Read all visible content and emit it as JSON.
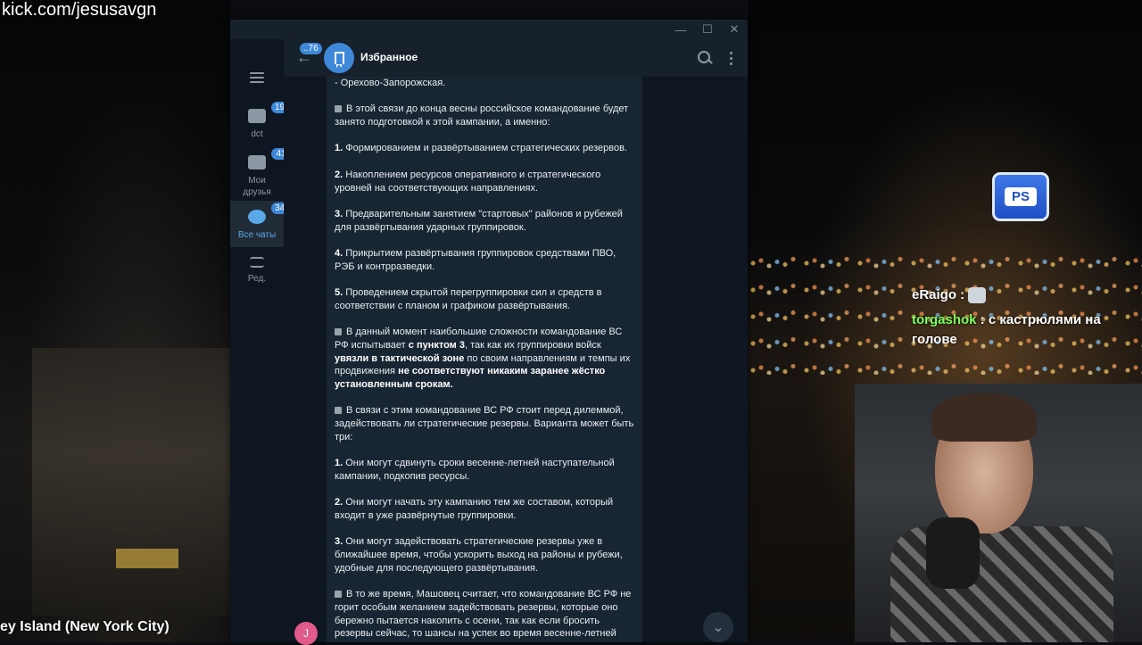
{
  "overlay": {
    "url": "kick.com/jesusavgn",
    "location": "ey Island (New York City)",
    "ps_badge": "PS"
  },
  "stream_chat": [
    {
      "user": "eRaigo",
      "sep": " :",
      "text": ""
    },
    {
      "user": "torgashok",
      "sep": " :",
      "text": " с кастрюлями на голове"
    }
  ],
  "window": {
    "min": "—",
    "max": "☐",
    "close": "✕"
  },
  "folders": [
    {
      "label": "dct",
      "badge": "191"
    },
    {
      "label": "Мои друзья",
      "badge": "41"
    },
    {
      "label": "Все чаты",
      "badge": "349"
    },
    {
      "label": "Ред.",
      "badge": ""
    }
  ],
  "header": {
    "back_badge": "..76",
    "title": "Избранное"
  },
  "message": {
    "paragraphs": [
      {
        "runs": [
          {
            "t": "- Орехово-Запорожская."
          }
        ]
      },
      {
        "bullet": true,
        "runs": [
          {
            "t": "В этой связи до конца весны российское командование будет занято подготовкой к этой кампании, а именно:"
          }
        ]
      },
      {
        "runs": [
          {
            "t": "1.",
            "b": true
          },
          {
            "t": " Формированием и развёртыванием стратегических резервов."
          }
        ]
      },
      {
        "runs": [
          {
            "t": "2.",
            "b": true
          },
          {
            "t": " Накоплением ресурсов оперативного и стратегического уровней на соответствующих направлениях."
          }
        ]
      },
      {
        "runs": [
          {
            "t": "3.",
            "b": true
          },
          {
            "t": " Предварительным занятием \"стартовых\" районов и рубежей для развёртывания ударных группировок."
          }
        ]
      },
      {
        "runs": [
          {
            "t": "4.",
            "b": true
          },
          {
            "t": " Прикрытием развёртывания группировок средствами ПВО, РЭБ и контрразведки."
          }
        ]
      },
      {
        "runs": [
          {
            "t": "5.",
            "b": true
          },
          {
            "t": " Проведением скрытой перегруппировки сил и средств в соответствии с планом и графиком развёртывания."
          }
        ]
      },
      {
        "bullet": true,
        "runs": [
          {
            "t": "В данный момент наибольшие сложности командование ВС РФ испытывает "
          },
          {
            "t": "с пунктом 3",
            "b": true
          },
          {
            "t": ", так как их группировки войск "
          },
          {
            "t": "увязли в тактической зоне",
            "b": true
          },
          {
            "t": " по своим направлениям и темпы их продвижения "
          },
          {
            "t": "не соответствуют никаким заранее жёстко установленным срокам.",
            "b": true
          }
        ]
      },
      {
        "bullet": true,
        "runs": [
          {
            "t": "В связи с этим командование ВС РФ стоит перед дилеммой, задействовать ли стратегические резервы. Варианта может быть три:"
          }
        ]
      },
      {
        "runs": [
          {
            "t": "1.",
            "b": true
          },
          {
            "t": " Они могут сдвинуть сроки весенне-летней наступательной кампании, подкопив ресурсы."
          }
        ]
      },
      {
        "runs": [
          {
            "t": "2.",
            "b": true
          },
          {
            "t": " Они могут начать эту кампанию тем же составом, который входит в уже развёрнутые группировки."
          }
        ]
      },
      {
        "runs": [
          {
            "t": "3.",
            "b": true
          },
          {
            "t": " Они могут задействовать стратегические резервы уже в ближайшее время, чтобы ускорить выход на районы и рубежи, удобные для последующего развёртывания."
          }
        ]
      },
      {
        "bullet": true,
        "runs": [
          {
            "t": "В то же время, Машовец считает, что командование ВС РФ не горит особым желанием задействовать резервы, которые оно бережно пытается накопить с осени, так как если бросить резервы сейчас, то шансы на успех во время весенне-летней"
          }
        ]
      }
    ]
  },
  "footer": {
    "avatar_letter": "J",
    "scroll_down": "⌄"
  },
  "colors": {
    "accent": "#3e88d8",
    "window_bg": "#17212b",
    "bubble_bg": "#182533",
    "chat_bg": "#0e1621"
  }
}
